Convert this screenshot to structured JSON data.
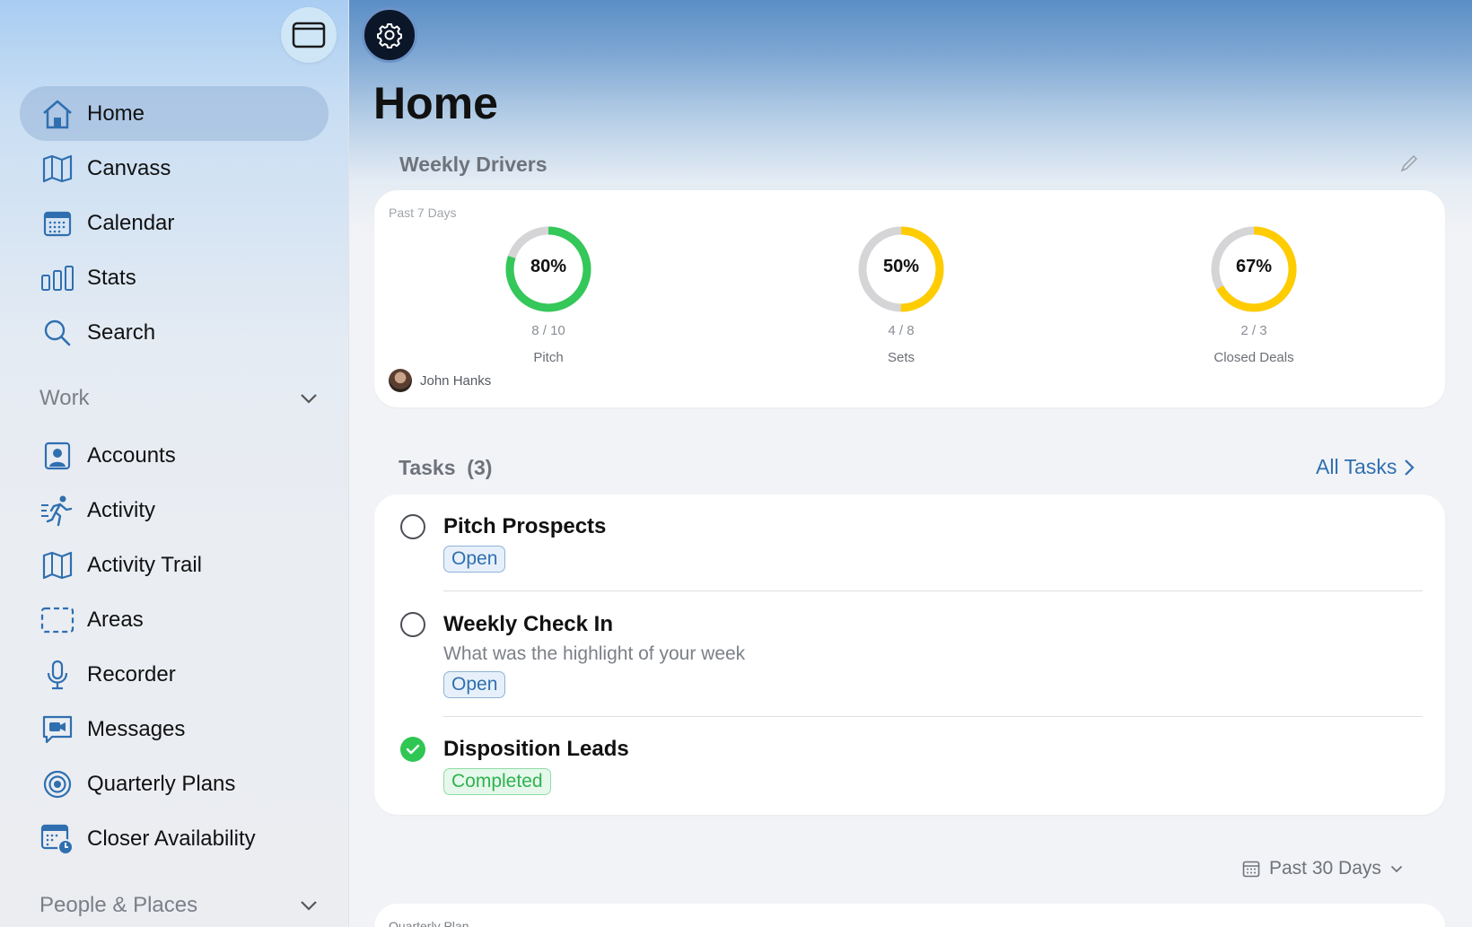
{
  "sidebar": {
    "nav_top": [
      {
        "label": "Home",
        "icon": "home-icon",
        "active": true
      },
      {
        "label": "Canvass",
        "icon": "map-icon"
      },
      {
        "label": "Calendar",
        "icon": "calendar-icon"
      },
      {
        "label": "Stats",
        "icon": "bar-chart-icon"
      },
      {
        "label": "Search",
        "icon": "search-icon"
      }
    ],
    "work_section": "Work",
    "nav_work": [
      {
        "label": "Accounts",
        "icon": "contact-card-icon"
      },
      {
        "label": "Activity",
        "icon": "running-figure-icon"
      },
      {
        "label": "Activity Trail",
        "icon": "map-icon"
      },
      {
        "label": "Areas",
        "icon": "dashed-rectangle-icon"
      },
      {
        "label": "Recorder",
        "icon": "microphone-icon"
      },
      {
        "label": "Messages",
        "icon": "video-message-icon"
      },
      {
        "label": "Quarterly Plans",
        "icon": "target-icon"
      },
      {
        "label": "Closer Availability",
        "icon": "calendar-clock-icon"
      }
    ],
    "people_section": "People & Places"
  },
  "main": {
    "title": "Home",
    "weekly_drivers": {
      "title": "Weekly Drivers",
      "period": "Past 7 Days",
      "owner": "John Hanks",
      "gauges": [
        {
          "pct": "80%",
          "fraction": "8 / 10",
          "name": "Pitch",
          "value": 0.8,
          "color": "#34c759"
        },
        {
          "pct": "50%",
          "fraction": "4 / 8",
          "name": "Sets",
          "value": 0.5,
          "color": "#ffcc00"
        },
        {
          "pct": "67%",
          "fraction": "2 / 3",
          "name": "Closed Deals",
          "value": 0.67,
          "color": "#ffcc00"
        }
      ]
    },
    "tasks": {
      "title": "Tasks  (3)",
      "all_link": "All Tasks",
      "items": [
        {
          "title": "Pitch Prospects",
          "subtitle": "",
          "status": "Open"
        },
        {
          "title": "Weekly Check In",
          "subtitle": "What was the highlight of your week",
          "status": "Open"
        },
        {
          "title": "Disposition Leads",
          "subtitle": "",
          "status": "Completed"
        }
      ]
    },
    "range_selector": "Past 30 Days",
    "quarterly_plan_label": "Quarterly Plan"
  },
  "colors": {
    "accent": "#2f6fb0",
    "green": "#34c759",
    "yellow": "#ffcc00",
    "track": "#d5d5d8"
  }
}
